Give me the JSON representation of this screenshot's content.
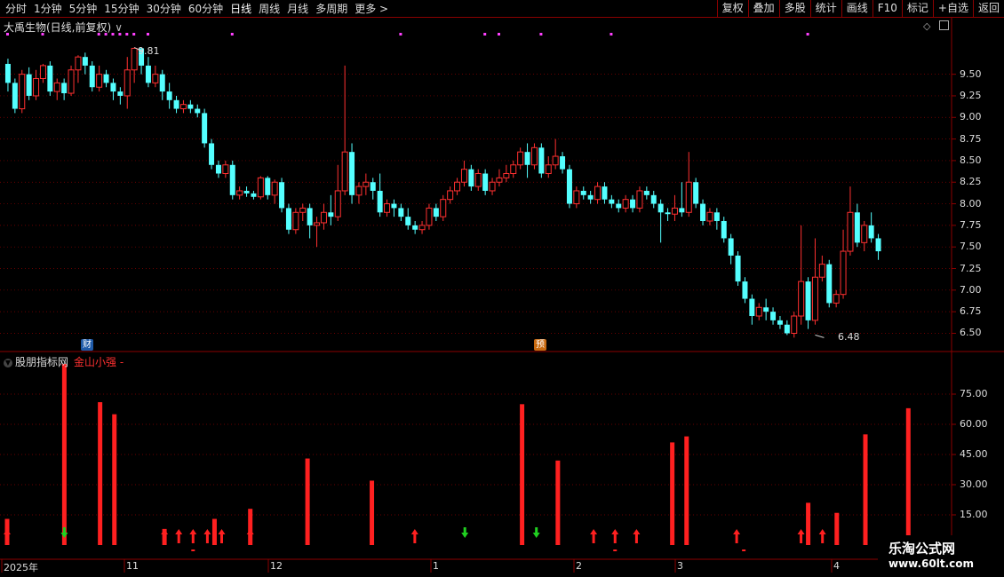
{
  "toolbar": {
    "periods": [
      "分时",
      "1分钟",
      "5分钟",
      "15分钟",
      "30分钟",
      "60分钟",
      "日线",
      "周线",
      "月线",
      "多周期",
      "更多 >"
    ],
    "active_period": "日线",
    "right_buttons": [
      "复权",
      "叠加",
      "多股",
      "统计",
      "画线",
      "F10",
      "标记",
      "+自选",
      "返回"
    ]
  },
  "main_chart": {
    "title": "大禹生物(日线,前复权)",
    "high_label": "9.81",
    "low_label": "6.48",
    "badges": [
      {
        "text": "财",
        "color": "#1e5aa8"
      },
      {
        "text": "预",
        "color": "#c86a10"
      }
    ]
  },
  "indicator": {
    "name": "股朋指标网",
    "sub": "金山小强 -"
  },
  "x_axis": [
    "2025年",
    "11",
    "12",
    "1",
    "2",
    "3",
    "4"
  ],
  "colors": {
    "up": "#ff3030",
    "down": "#54ffff",
    "grid": "#8b0000",
    "buy": "#ff2020",
    "sell": "#20d020"
  },
  "watermark": {
    "title": "乐淘公式网",
    "url": "www.60lt.com"
  },
  "chart_data": [
    {
      "type": "candlestick",
      "y_ticks": [
        "9.50",
        "9.25",
        "9.00",
        "8.75",
        "8.50",
        "8.25",
        "8.00",
        "7.75",
        "7.50",
        "7.25",
        "7.00",
        "6.75",
        "6.50"
      ],
      "ylim": [
        6.33,
        10.0
      ],
      "candles": [
        [
          9.62,
          9.4,
          9.68,
          9.3
        ],
        [
          9.4,
          9.1,
          9.45,
          9.05
        ],
        [
          9.1,
          9.5,
          9.55,
          9.05
        ],
        [
          9.5,
          9.25,
          9.58,
          9.2
        ],
        [
          9.25,
          9.45,
          9.55,
          9.2
        ],
        [
          9.45,
          9.6,
          9.62,
          9.4
        ],
        [
          9.6,
          9.3,
          9.65,
          9.25
        ],
        [
          9.3,
          9.4,
          9.45,
          9.2
        ],
        [
          9.4,
          9.28,
          9.45,
          9.2
        ],
        [
          9.28,
          9.55,
          9.6,
          9.25
        ],
        [
          9.55,
          9.7,
          9.72,
          9.4
        ],
        [
          9.7,
          9.6,
          9.75,
          9.5
        ],
        [
          9.6,
          9.35,
          9.65,
          9.3
        ],
        [
          9.35,
          9.5,
          9.6,
          9.3
        ],
        [
          9.5,
          9.4,
          9.55,
          9.35
        ],
        [
          9.4,
          9.3,
          9.45,
          9.2
        ],
        [
          9.3,
          9.25,
          9.35,
          9.15
        ],
        [
          9.25,
          9.55,
          9.7,
          9.1
        ],
        [
          9.55,
          9.8,
          9.81,
          9.4
        ],
        [
          9.8,
          9.6,
          9.81,
          9.5
        ],
        [
          9.6,
          9.4,
          9.7,
          9.35
        ],
        [
          9.4,
          9.5,
          9.6,
          9.35
        ],
        [
          9.5,
          9.3,
          9.55,
          9.2
        ],
        [
          9.3,
          9.2,
          9.4,
          9.1
        ],
        [
          9.2,
          9.1,
          9.25,
          9.05
        ],
        [
          9.1,
          9.15,
          9.2,
          9.05
        ],
        [
          9.15,
          9.1,
          9.2,
          9.05
        ],
        [
          9.1,
          9.05,
          9.15,
          9.0
        ],
        [
          9.05,
          8.7,
          9.1,
          8.65
        ],
        [
          8.7,
          8.45,
          8.75,
          8.4
        ],
        [
          8.45,
          8.35,
          8.5,
          8.3
        ],
        [
          8.35,
          8.45,
          8.5,
          8.3
        ],
        [
          8.45,
          8.1,
          8.5,
          8.05
        ],
        [
          8.1,
          8.15,
          8.2,
          8.05
        ],
        [
          8.15,
          8.12,
          8.2,
          8.08
        ],
        [
          8.12,
          8.08,
          8.15,
          8.05
        ],
        [
          8.08,
          8.3,
          8.32,
          8.05
        ],
        [
          8.3,
          8.1,
          8.32,
          8.05
        ],
        [
          8.1,
          8.25,
          8.28,
          8.0
        ],
        [
          8.25,
          7.95,
          8.3,
          7.9
        ],
        [
          7.95,
          7.7,
          8.0,
          7.65
        ],
        [
          7.7,
          7.9,
          7.95,
          7.65
        ],
        [
          7.9,
          7.95,
          8.0,
          7.8
        ],
        [
          7.95,
          7.75,
          8.0,
          7.6
        ],
        [
          7.75,
          7.78,
          7.85,
          7.5
        ],
        [
          7.78,
          7.9,
          8.0,
          7.7
        ],
        [
          7.9,
          7.85,
          8.1,
          7.75
        ],
        [
          7.85,
          8.15,
          8.45,
          7.8
        ],
        [
          8.15,
          8.6,
          9.6,
          8.1
        ],
        [
          8.6,
          8.1,
          8.7,
          8.0
        ],
        [
          8.1,
          8.2,
          8.25,
          8.0
        ],
        [
          8.2,
          8.25,
          8.35,
          8.1
        ],
        [
          8.25,
          8.15,
          8.3,
          8.05
        ],
        [
          8.15,
          7.9,
          8.35,
          7.85
        ],
        [
          7.9,
          8.0,
          8.05,
          7.85
        ],
        [
          8.0,
          7.95,
          8.05,
          7.85
        ],
        [
          7.95,
          7.85,
          8.0,
          7.8
        ],
        [
          7.85,
          7.75,
          7.95,
          7.7
        ],
        [
          7.75,
          7.7,
          7.8,
          7.65
        ],
        [
          7.7,
          7.75,
          7.8,
          7.65
        ],
        [
          7.75,
          7.95,
          8.0,
          7.7
        ],
        [
          7.95,
          7.85,
          8.0,
          7.8
        ],
        [
          7.85,
          8.05,
          8.1,
          7.8
        ],
        [
          8.05,
          8.15,
          8.2,
          8.0
        ],
        [
          8.15,
          8.25,
          8.3,
          8.1
        ],
        [
          8.25,
          8.4,
          8.5,
          8.2
        ],
        [
          8.4,
          8.2,
          8.45,
          8.15
        ],
        [
          8.2,
          8.35,
          8.4,
          8.15
        ],
        [
          8.35,
          8.15,
          8.4,
          8.1
        ],
        [
          8.15,
          8.25,
          8.3,
          8.1
        ],
        [
          8.25,
          8.3,
          8.4,
          8.2
        ],
        [
          8.3,
          8.35,
          8.45,
          8.25
        ],
        [
          8.35,
          8.45,
          8.5,
          8.3
        ],
        [
          8.45,
          8.6,
          8.65,
          8.4
        ],
        [
          8.6,
          8.45,
          8.7,
          8.3
        ],
        [
          8.45,
          8.65,
          8.7,
          8.4
        ],
        [
          8.65,
          8.35,
          8.7,
          8.3
        ],
        [
          8.35,
          8.45,
          8.55,
          8.3
        ],
        [
          8.45,
          8.55,
          8.75,
          8.4
        ],
        [
          8.55,
          8.4,
          8.6,
          8.35
        ],
        [
          8.4,
          8.0,
          8.45,
          7.95
        ],
        [
          8.0,
          8.15,
          8.2,
          7.95
        ],
        [
          8.15,
          8.1,
          8.2,
          8.05
        ],
        [
          8.1,
          8.05,
          8.15,
          8.0
        ],
        [
          8.05,
          8.2,
          8.25,
          8.0
        ],
        [
          8.2,
          8.05,
          8.25,
          8.0
        ],
        [
          8.05,
          8.0,
          8.1,
          7.95
        ],
        [
          8.0,
          7.95,
          8.05,
          7.9
        ],
        [
          7.95,
          8.05,
          8.1,
          7.9
        ],
        [
          8.05,
          7.95,
          8.1,
          7.9
        ],
        [
          7.95,
          8.15,
          8.2,
          7.9
        ],
        [
          8.15,
          8.1,
          8.2,
          8.05
        ],
        [
          8.1,
          8.0,
          8.15,
          7.95
        ],
        [
          8.0,
          7.9,
          8.05,
          7.55
        ],
        [
          7.9,
          7.88,
          7.95,
          7.8
        ],
        [
          7.88,
          7.95,
          8.1,
          7.8
        ],
        [
          7.95,
          7.9,
          8.25,
          7.85
        ],
        [
          7.9,
          8.25,
          8.6,
          7.85
        ],
        [
          8.25,
          8.0,
          8.3,
          7.95
        ],
        [
          8.0,
          7.8,
          8.05,
          7.75
        ],
        [
          7.8,
          7.9,
          7.95,
          7.75
        ],
        [
          7.9,
          7.8,
          7.95,
          7.7
        ],
        [
          7.8,
          7.6,
          7.85,
          7.55
        ],
        [
          7.6,
          7.4,
          7.65,
          7.3
        ],
        [
          7.4,
          7.1,
          7.45,
          7.05
        ],
        [
          7.1,
          6.9,
          7.15,
          6.85
        ],
        [
          6.9,
          6.7,
          6.95,
          6.6
        ],
        [
          6.7,
          6.8,
          6.85,
          6.65
        ],
        [
          6.8,
          6.75,
          6.9,
          6.65
        ],
        [
          6.75,
          6.65,
          6.8,
          6.6
        ],
        [
          6.65,
          6.6,
          6.7,
          6.55
        ],
        [
          6.6,
          6.5,
          6.65,
          6.48
        ],
        [
          6.5,
          6.7,
          6.75,
          6.45
        ],
        [
          6.7,
          7.1,
          7.75,
          6.6
        ],
        [
          7.1,
          6.65,
          7.15,
          6.55
        ],
        [
          6.65,
          7.15,
          7.6,
          6.6
        ],
        [
          7.15,
          7.3,
          7.4,
          7.1
        ],
        [
          7.3,
          6.85,
          7.35,
          6.8
        ],
        [
          6.85,
          6.95,
          7.0,
          6.8
        ],
        [
          6.95,
          7.45,
          7.7,
          6.9
        ],
        [
          7.45,
          7.9,
          8.2,
          7.4
        ],
        [
          7.9,
          7.55,
          8.0,
          7.5
        ],
        [
          7.55,
          7.75,
          7.8,
          7.45
        ],
        [
          7.75,
          7.6,
          7.9,
          7.55
        ],
        [
          7.6,
          7.45,
          7.65,
          7.35
        ]
      ]
    },
    {
      "type": "bar",
      "y_ticks": [
        "75.00",
        "60.00",
        "45.00",
        "30.00",
        "15.00"
      ],
      "ylim": [
        0,
        90
      ],
      "bars": [
        [
          0,
          13
        ],
        [
          8,
          90
        ],
        [
          13,
          71
        ],
        [
          15,
          65
        ],
        [
          22,
          8
        ],
        [
          29,
          13
        ],
        [
          34,
          18
        ],
        [
          42,
          43
        ],
        [
          51,
          32
        ],
        [
          72,
          70
        ],
        [
          77,
          42
        ],
        [
          93,
          51
        ],
        [
          95,
          54
        ],
        [
          112,
          21
        ],
        [
          116,
          16
        ],
        [
          120,
          55
        ],
        [
          126,
          68
        ]
      ],
      "buy_arrows": [
        0,
        22,
        24,
        26,
        28,
        30,
        34,
        57,
        82,
        85,
        88,
        102,
        111,
        114
      ],
      "sell_arrows": [
        8,
        64,
        74
      ],
      "small_marks": [
        26,
        85,
        103
      ]
    }
  ]
}
